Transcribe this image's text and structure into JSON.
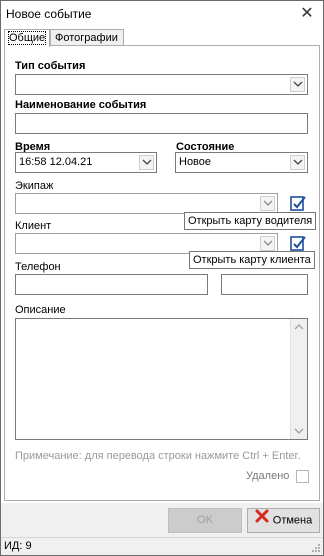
{
  "window": {
    "title": "Новое событие"
  },
  "tabs": [
    {
      "label": "Общие"
    },
    {
      "label": "Фотографии"
    }
  ],
  "form": {
    "event_type_label": "Тип события",
    "event_type_value": "",
    "event_name_label": "Наименование события",
    "event_name_value": "",
    "time_label": "Время",
    "time_value": "16:58 12.04.21",
    "state_label": "Состояние",
    "state_value": "Новое",
    "crew_label": "Экипаж",
    "crew_value": "",
    "crew_tooltip": "Открыть карту водителя",
    "client_label": "Клиент",
    "client_value": "",
    "client_tooltip": "Открыть карту клиента",
    "phone_label": "Телефон",
    "phone_value": "",
    "description_label": "Описание",
    "description_value": "",
    "note": "Примечание: для перевода строки нажмите Ctrl + Enter.",
    "deleted_label": "Удалено",
    "deleted_checked": false
  },
  "buttons": {
    "ok": "OK",
    "cancel": "Отмена"
  },
  "status": {
    "id_text": "ИД: 9"
  }
}
